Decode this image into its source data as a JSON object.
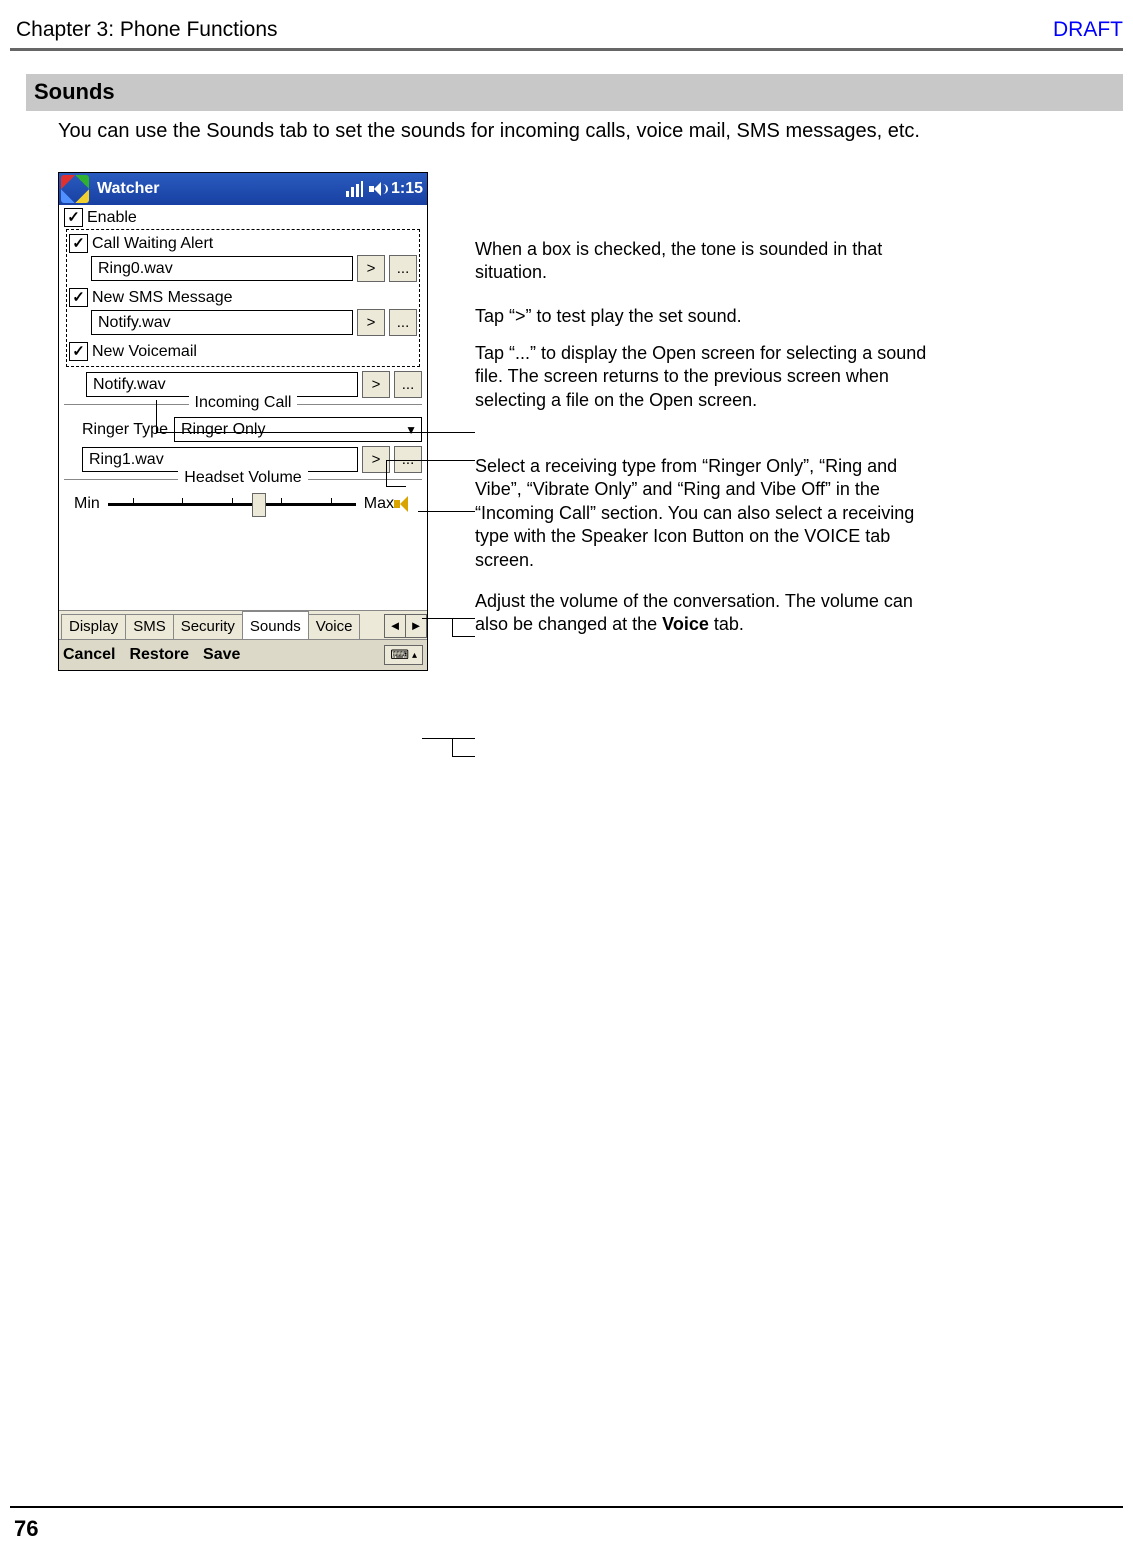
{
  "header": {
    "chapter": "Chapter 3: Phone Functions",
    "draft": "DRAFT"
  },
  "section_title": "Sounds",
  "intro": "You can use the Sounds tab to set the sounds for incoming calls, voice mail, SMS messages, etc.",
  "screenshot": {
    "titlebar": {
      "app": "Watcher",
      "time": "1:15"
    },
    "enable_label": "Enable",
    "items": [
      {
        "label": "Call Waiting Alert",
        "sound": "Ring0.wav"
      },
      {
        "label": "New SMS Message",
        "sound": "Notify.wav"
      },
      {
        "label": "New Voicemail",
        "sound": "Notify.wav"
      }
    ],
    "play_btn": ">",
    "browse_btn": "...",
    "incoming_section": "Incoming Call",
    "ringer_type_label": "Ringer Type",
    "ringer_type_value": "Ringer Only",
    "ring_sound": "Ring1.wav",
    "headset_section": "Headset Volume",
    "min": "Min",
    "max": "Max",
    "tabs": [
      "Display",
      "SMS",
      "Security",
      "Sounds",
      "Voice"
    ],
    "menu": {
      "cancel": "Cancel",
      "restore": "Restore",
      "save": "Save"
    }
  },
  "callouts": {
    "c1": "When a box is checked, the tone is sounded in that situation.",
    "c2": "Tap “>” to test play the set sound.",
    "c3": "Tap “...” to display the Open screen for selecting a sound file.  The screen returns to the previous screen when selecting a file on the Open screen.",
    "c4": "Select a receiving type from “Ringer Only”, “Ring and Vibe”, “Vibrate Only” and “Ring and Vibe Off” in the “Incoming Call” section. You can also select a receiving type with the Speaker Icon Button on the VOICE tab screen.",
    "c5a": "Adjust the volume of the conversation. The volume can also be changed at the ",
    "c5b": "Voice",
    "c5c": " tab."
  },
  "page_number": "76"
}
